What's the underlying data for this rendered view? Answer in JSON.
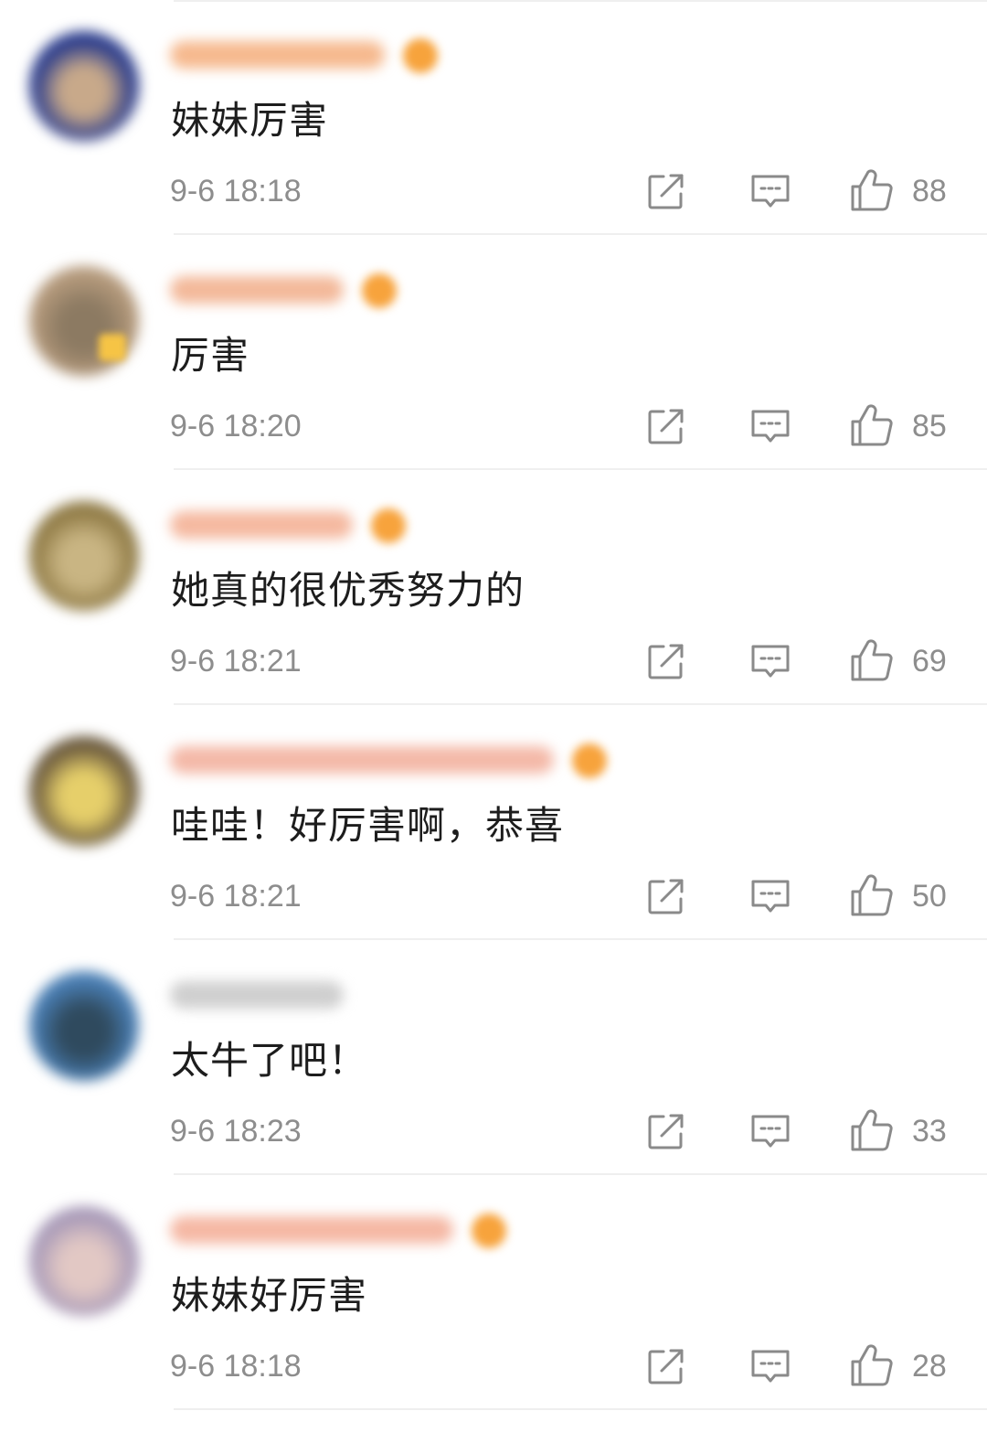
{
  "colors": {
    "icon": "#8a8a8a",
    "text": "#1d1d1d",
    "meta": "#8d8d8d",
    "badge": "#f7a33c"
  },
  "comments": [
    {
      "text": "妹妹厉害",
      "time": "9-6 18:18",
      "likes": "88",
      "avatar_color": "#283a8c",
      "avatar_inner": "#c8a98a",
      "username_color": "#f6b98e",
      "username_width": 235,
      "has_badge": true,
      "has_vip": false
    },
    {
      "text": "厉害",
      "time": "9-6 18:20",
      "likes": "85",
      "avatar_color": "#b59a7c",
      "avatar_inner": "#8c7a62",
      "username_color": "#f3b99a",
      "username_width": 190,
      "has_badge": true,
      "has_vip": true
    },
    {
      "text": "她真的很优秀努力的",
      "time": "9-6 18:21",
      "likes": "69",
      "avatar_color": "#8f7a45",
      "avatar_inner": "#c9b583",
      "username_color": "#f5b9a0",
      "username_width": 200,
      "has_badge": true,
      "has_vip": false
    },
    {
      "text": "哇哇！好厉害啊，恭喜",
      "time": "9-6 18:21",
      "likes": "50",
      "avatar_color": "#6b5a3e",
      "avatar_inner": "#e6cf6a",
      "username_color": "#f4b9a8",
      "username_width": 420,
      "has_badge": true,
      "has_vip": false
    },
    {
      "text": "太牛了吧！",
      "time": "9-6 18:23",
      "likes": "33",
      "avatar_color": "#4a7fb5",
      "avatar_inner": "#2f4a5e",
      "username_color": "#cfcfcf",
      "username_width": 190,
      "has_badge": false,
      "has_vip": false
    },
    {
      "text": "妹妹好厉害",
      "time": "9-6 18:18",
      "likes": "28",
      "avatar_color": "#a89ab8",
      "avatar_inner": "#e2c8c4",
      "username_color": "#f5b8a4",
      "username_width": 310,
      "has_badge": true,
      "has_vip": false
    }
  ],
  "icons": {
    "repost": "repost-icon",
    "reply": "reply-icon",
    "like": "thumbs-up-icon"
  }
}
